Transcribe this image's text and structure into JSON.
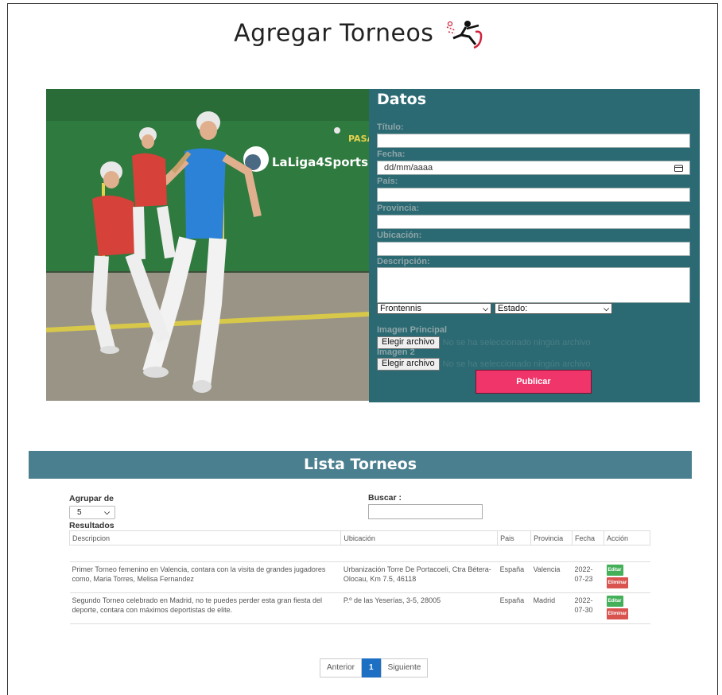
{
  "header": {
    "title": "Agregar Torneos",
    "logo_icon": "tennis-player-icon"
  },
  "form": {
    "heading": "Datos",
    "titulo_label": "Título:",
    "fecha_label": "Fecha:",
    "fecha_placeholder": "dd/mm/aaaa",
    "pais_label": "País:",
    "provincia_label": "Provincia:",
    "ubicacion_label": "Ubicación:",
    "descripcion_label": "Descripción:",
    "deporte_select": "Frontennis",
    "estado_select": "Estado:",
    "imagen_principal_label": "Imagen Principal",
    "imagen2_label": "Imagen 2",
    "file_button": "Elegir archivo",
    "no_file_text": "No se ha seleccionado ningún archivo",
    "publish_button": "Publicar"
  },
  "photo": {
    "banner_text": "LaLiga4Sports",
    "side_text": "PASA"
  },
  "list": {
    "heading": "Lista Torneos",
    "group_label": "Agrupar de",
    "group_value": "5",
    "search_label": "Buscar :",
    "results_label": "Resultados",
    "columns": [
      "Descripcion",
      "Ubicación",
      "Pais",
      "Provincia",
      "Fecha",
      "Acción"
    ],
    "rows": [
      {
        "descripcion": "Primer Torneo femenino en Valencia, contara con la visita de grandes jugadores como, Maria Torres, Melisa Fernandez",
        "ubicacion": "Urbanización Torre De Portacoeli, Ctra Bétera- Olocau, Km 7.5, 46118",
        "pais": "España",
        "provincia": "Valencia",
        "fecha": "2022-07-23"
      },
      {
        "descripcion": "Segundo Torneo celebrado en Madrid, no te puedes perder esta gran fiesta del deporte, contara con máximos deportistas de elite.",
        "ubicacion": "P.º de las Yeserías, 3-5, 28005",
        "pais": "España",
        "provincia": "Madrid",
        "fecha": "2022-07-30"
      }
    ],
    "edit_label": "Editar",
    "delete_label": "Eliminar"
  },
  "pagination": {
    "prev": "Anterior",
    "current": "1",
    "next": "Siguiente"
  },
  "colors": {
    "panel": "#2b6a73",
    "list_bar": "#4a7f8f",
    "publish": "#f0356b",
    "page_active": "#1d6fc4"
  }
}
